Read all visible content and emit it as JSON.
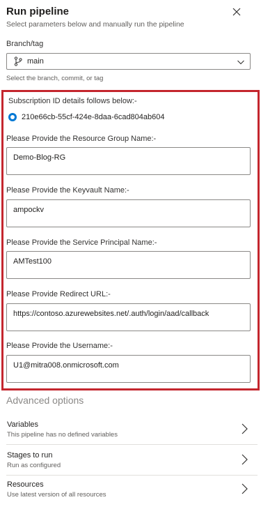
{
  "panel": {
    "title": "Run pipeline",
    "subtitle": "Select parameters below and manually run the pipeline",
    "close_icon": "close-icon"
  },
  "branch": {
    "label": "Branch/tag",
    "value": "main",
    "hint": "Select the branch, commit, or tag"
  },
  "params": {
    "subscription_label": "Subscription ID details follows below:-",
    "subscription_value": "210e66cb-55cf-424e-8daa-6cad804ab604",
    "resource_group_label": "Please Provide the Resource Group Name:-",
    "resource_group_value": "Demo-Blog-RG",
    "keyvault_label": "Please Provide the Keyvault Name:-",
    "keyvault_value": "ampockv",
    "sp_label": "Please Provide the Service Principal Name:-",
    "sp_value": "AMTest100",
    "redirect_label": "Please Provide Redirect URL:-",
    "redirect_value": "https://contoso.azurewebsites.net/.auth/login/aad/callback",
    "username_label": "Please Provide the Username:-",
    "username_value": "U1@mitra008.onmicrosoft.com"
  },
  "advanced": {
    "heading": "Advanced options",
    "items": [
      {
        "title": "Variables",
        "subtitle": "This pipeline has no defined variables"
      },
      {
        "title": "Stages to run",
        "subtitle": "Run as configured"
      },
      {
        "title": "Resources",
        "subtitle": "Use latest version of all resources"
      }
    ]
  },
  "colors": {
    "highlight_border": "#c4262e",
    "radio": "#0078d4"
  }
}
